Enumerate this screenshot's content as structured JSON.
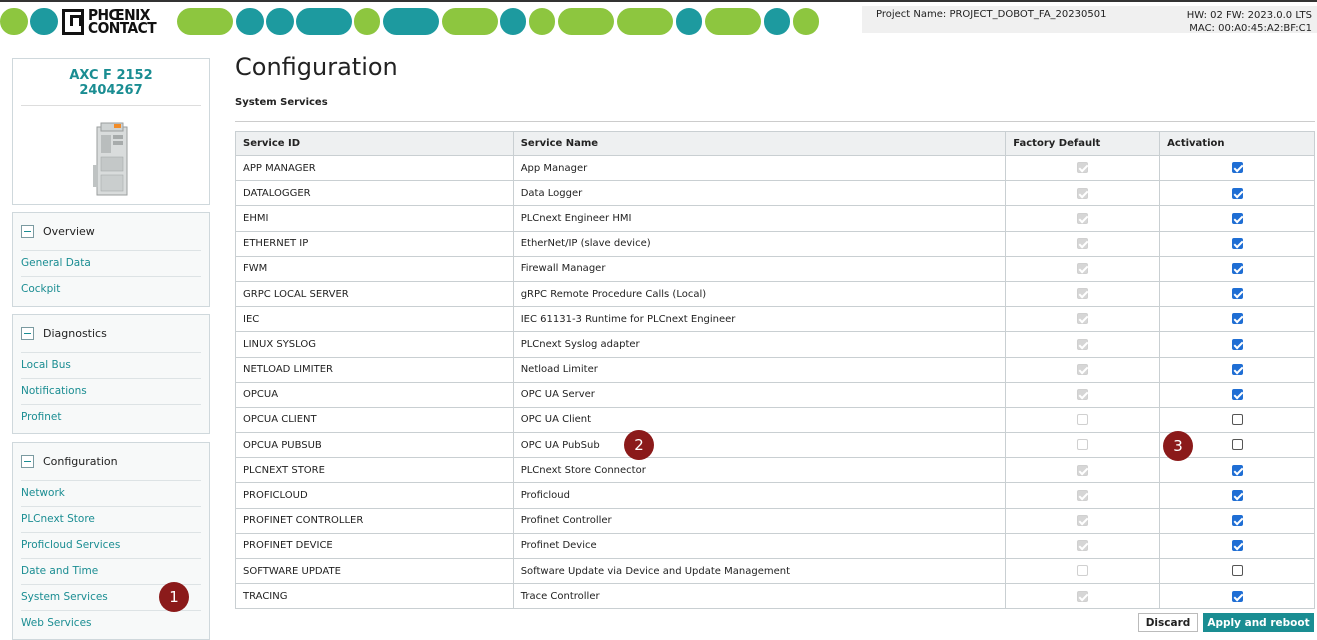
{
  "header": {
    "logo_line1": "PHŒNIX",
    "logo_line2": "CONTACT",
    "project": "Project Name: PROJECT_DOBOT_FA_20230501",
    "hw": "HW: 02 FW: 2023.0.0 LTS",
    "mac": "MAC: 00:A0:45:A2:BF:C1",
    "brand_colors": {
      "green": "#8dc63f",
      "teal": "#1d9a9f"
    }
  },
  "device": {
    "model": "AXC F 2152",
    "article": "2404267"
  },
  "sidebar": {
    "overview": {
      "title": "Overview",
      "items": [
        "General Data",
        "Cockpit"
      ]
    },
    "diagnostics": {
      "title": "Diagnostics",
      "items": [
        "Local Bus",
        "Notifications",
        "Profinet"
      ]
    },
    "configuration": {
      "title": "Configuration",
      "items": [
        "Network",
        "PLCnext Store",
        "Proficloud Services",
        "Date and Time",
        "System Services",
        "Web Services"
      ]
    }
  },
  "markers": [
    "1",
    "2",
    "3"
  ],
  "main": {
    "title": "Configuration",
    "subtitle": "System Services",
    "columns": [
      "Service ID",
      "Service Name",
      "Factory Default",
      "Activation"
    ],
    "rows": [
      {
        "id": "APP MANAGER",
        "name": "App Manager",
        "factory": "checked",
        "active": true
      },
      {
        "id": "DATALOGGER",
        "name": "Data Logger",
        "factory": "checked",
        "active": true
      },
      {
        "id": "EHMI",
        "name": "PLCnext Engineer HMI",
        "factory": "checked",
        "active": true
      },
      {
        "id": "ETHERNET IP",
        "name": "EtherNet/IP (slave device)",
        "factory": "checked",
        "active": true
      },
      {
        "id": "FWM",
        "name": "Firewall Manager",
        "factory": "checked",
        "active": true
      },
      {
        "id": "GRPC LOCAL SERVER",
        "name": "gRPC Remote Procedure Calls (Local)",
        "factory": "checked",
        "active": true
      },
      {
        "id": "IEC",
        "name": "IEC 61131-3 Runtime for PLCnext Engineer",
        "factory": "checked",
        "active": true
      },
      {
        "id": "LINUX SYSLOG",
        "name": "PLCnext Syslog adapter",
        "factory": "checked",
        "active": true
      },
      {
        "id": "NETLOAD LIMITER",
        "name": "Netload Limiter",
        "factory": "checked",
        "active": true
      },
      {
        "id": "OPCUA",
        "name": "OPC UA Server",
        "factory": "checked",
        "active": true
      },
      {
        "id": "OPCUA CLIENT",
        "name": "OPC UA Client",
        "factory": "unchecked",
        "active": false
      },
      {
        "id": "OPCUA PUBSUB",
        "name": "OPC UA PubSub",
        "factory": "unchecked",
        "active": false
      },
      {
        "id": "PLCNEXT STORE",
        "name": "PLCnext Store Connector",
        "factory": "checked",
        "active": true
      },
      {
        "id": "PROFICLOUD",
        "name": "Proficloud",
        "factory": "checked",
        "active": true
      },
      {
        "id": "PROFINET CONTROLLER",
        "name": "Profinet Controller",
        "factory": "checked",
        "active": true
      },
      {
        "id": "PROFINET DEVICE",
        "name": "Profinet Device",
        "factory": "checked",
        "active": true
      },
      {
        "id": "SOFTWARE UPDATE",
        "name": "Software Update via Device and Update Management",
        "factory": "unchecked",
        "active": false
      },
      {
        "id": "TRACING",
        "name": "Trace Controller",
        "factory": "checked",
        "active": true
      }
    ]
  },
  "buttons": {
    "discard": "Discard",
    "apply": "Apply and reboot"
  }
}
